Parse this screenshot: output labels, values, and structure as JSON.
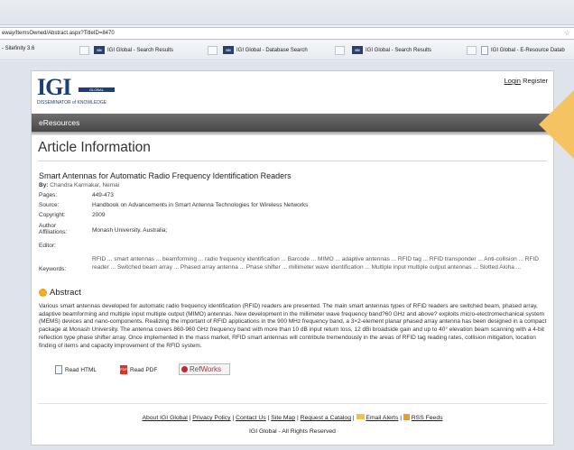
{
  "browser": {
    "url": "eway/ItemsOwned/Abstract.aspx?TitleID=8470",
    "bookmarks": [
      {
        "label": "- Sitefinity 3.6",
        "fav": ""
      },
      {
        "label": "IGI Global - Search Results",
        "fav": "IGI"
      },
      {
        "label": "IGI Global - Database Search",
        "fav": "IGI"
      },
      {
        "label": "IGI Global - Search Results",
        "fav": "IGI"
      },
      {
        "label": "IGI Global - E-Resource Datab",
        "fav": ""
      }
    ]
  },
  "header": {
    "logo_text": "IGI",
    "logo_global": "GLOBAL",
    "logo_tagline": "DISSEMINATOR of KNOWLEDGE",
    "login": "Login",
    "register": "Register"
  },
  "nav": {
    "label": "eResources"
  },
  "page_title": "Article Information",
  "article": {
    "title": "Smart Antennas for Automatic Radio Frequency Identification Readers",
    "by_label": "By:",
    "authors": "Chandra Karmakar, Nemai",
    "meta": [
      {
        "key": "Pages:",
        "value": "449-473"
      },
      {
        "key": "Source:",
        "value": "Handbook on Advancements in Smart Antenna Technologies for Wireless Networks"
      },
      {
        "key": "Copyright:",
        "value": "2009"
      },
      {
        "key": "Author Affiliations:",
        "value": "Monash University, Australia;"
      },
      {
        "key": "Editor:",
        "value": ""
      }
    ],
    "keywords_label": "Keywords:",
    "keywords": "RFID ... smart antennas ... beamforming ... radio frequency identification ... Barcode ... MIMO ... adaptive antennas ... RFID tag ... RFID transponder ... Anti-collision ... RFID reader ... Switched beam array ... Phased array antenna ... Phase shifter ... millimeter wave identification ... Multiple input multiple output antennas ... Slotted Aloha ..."
  },
  "abstract": {
    "heading": "Abstract",
    "text": "Various smart antennas developed for automatic radio frequency identification (RFID) readers are presented. The main smart antennas types of RFID readers are switched beam, phased array, adaptive beamforming and multiple input multiple output (MIMO) antennas. New development in the millimeter wave frequency band?60 GHz and above? exploits micro-electromechanical system (MEMS) devices and nano-components. Realizing the important of RFID applications in the 900 MHz frequency band, a 3×2-element planar phased array antenna has been designed in a compact package at Monash University. The antenna covers 860-960 GHz frequency band with more than 10 dB input return loss, 12 dBi broadside gain and up to 40° elevation beam scanning with a 4-bit reflection type phase shifter array. Once implemented in the mass market, RFID smart antennas will contribute tremendously in the areas of RFID tag reading rates, collision mitigation, location finding of items and capacity improvement of the RFID system."
  },
  "actions": {
    "read_html": "Read HTML",
    "read_pdf": "Read PDF",
    "refworks_ref": "Ref",
    "refworks_works": "Works"
  },
  "footer": {
    "links": [
      "About IGI Global",
      "Privacy Policy",
      "Contact Us",
      "Site Map",
      "Request a Catalog",
      "Email Alerts",
      "RSS Feeds"
    ],
    "sep": "|",
    "copyright": "IGI Global - All Rights Reserved"
  },
  "colors": {
    "brand": "#1c3e79",
    "nav": "#5a5a5a",
    "accent": "#f5c361",
    "refworks": "#c7282f"
  }
}
